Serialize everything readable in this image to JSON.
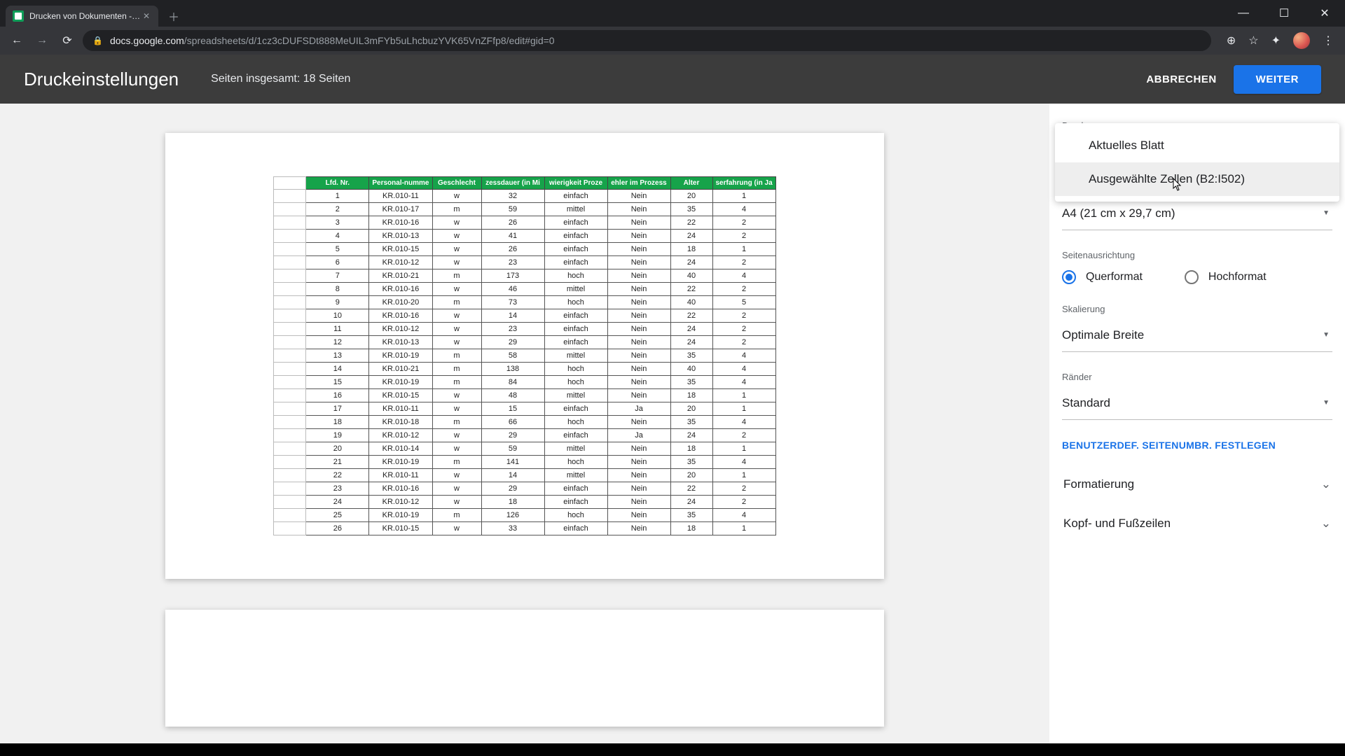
{
  "browser": {
    "tab_title": "Drucken von Dokumenten - Goo",
    "url_host": "docs.google.com",
    "url_path": "/spreadsheets/d/1cz3cDUFSDt888MeUIL3mFYb5uLhcbuzYVK65VnZFfp8/edit#gid=0"
  },
  "header": {
    "title": "Druckeinstellungen",
    "summary": "Seiten insgesamt: 18 Seiten",
    "cancel": "ABBRECHEN",
    "next": "WEITER"
  },
  "sidebar": {
    "print_label": "Drucken",
    "print_option1": "Aktuelles Blatt",
    "print_option2": "Ausgewählte Zellen (B2:I502)",
    "paper_size": "A4 (21 cm x 29,7 cm)",
    "orientation_label": "Seitenausrichtung",
    "orientation_landscape": "Querformat",
    "orientation_portrait": "Hochformat",
    "scaling_label": "Skalierung",
    "scaling_value": "Optimale Breite",
    "margins_label": "Ränder",
    "margins_value": "Standard",
    "custom_breaks": "BENUTZERDEF. SEITENUMBR. FESTLEGEN",
    "formatting": "Formatierung",
    "headers_footers": "Kopf- und Fußzeilen"
  },
  "table": {
    "headers": [
      "Lfd. Nr.",
      "Personal-numme",
      "Geschlecht",
      "zessdauer (in Mi",
      "wierigkeit Proze",
      "ehler im Prozess",
      "Alter",
      "serfahrung (in Ja"
    ],
    "rows": [
      [
        "1",
        "KR.010-11",
        "w",
        "32",
        "einfach",
        "Nein",
        "20",
        "1"
      ],
      [
        "2",
        "KR.010-17",
        "m",
        "59",
        "mittel",
        "Nein",
        "35",
        "4"
      ],
      [
        "3",
        "KR.010-16",
        "w",
        "26",
        "einfach",
        "Nein",
        "22",
        "2"
      ],
      [
        "4",
        "KR.010-13",
        "w",
        "41",
        "einfach",
        "Nein",
        "24",
        "2"
      ],
      [
        "5",
        "KR.010-15",
        "w",
        "26",
        "einfach",
        "Nein",
        "18",
        "1"
      ],
      [
        "6",
        "KR.010-12",
        "w",
        "23",
        "einfach",
        "Nein",
        "24",
        "2"
      ],
      [
        "7",
        "KR.010-21",
        "m",
        "173",
        "hoch",
        "Nein",
        "40",
        "4"
      ],
      [
        "8",
        "KR.010-16",
        "w",
        "46",
        "mittel",
        "Nein",
        "22",
        "2"
      ],
      [
        "9",
        "KR.010-20",
        "m",
        "73",
        "hoch",
        "Nein",
        "40",
        "5"
      ],
      [
        "10",
        "KR.010-16",
        "w",
        "14",
        "einfach",
        "Nein",
        "22",
        "2"
      ],
      [
        "11",
        "KR.010-12",
        "w",
        "23",
        "einfach",
        "Nein",
        "24",
        "2"
      ],
      [
        "12",
        "KR.010-13",
        "w",
        "29",
        "einfach",
        "Nein",
        "24",
        "2"
      ],
      [
        "13",
        "KR.010-19",
        "m",
        "58",
        "mittel",
        "Nein",
        "35",
        "4"
      ],
      [
        "14",
        "KR.010-21",
        "m",
        "138",
        "hoch",
        "Nein",
        "40",
        "4"
      ],
      [
        "15",
        "KR.010-19",
        "m",
        "84",
        "hoch",
        "Nein",
        "35",
        "4"
      ],
      [
        "16",
        "KR.010-15",
        "w",
        "48",
        "mittel",
        "Nein",
        "18",
        "1"
      ],
      [
        "17",
        "KR.010-11",
        "w",
        "15",
        "einfach",
        "Ja",
        "20",
        "1"
      ],
      [
        "18",
        "KR.010-18",
        "m",
        "66",
        "hoch",
        "Nein",
        "35",
        "4"
      ],
      [
        "19",
        "KR.010-12",
        "w",
        "29",
        "einfach",
        "Ja",
        "24",
        "2"
      ],
      [
        "20",
        "KR.010-14",
        "w",
        "59",
        "mittel",
        "Nein",
        "18",
        "1"
      ],
      [
        "21",
        "KR.010-19",
        "m",
        "141",
        "hoch",
        "Nein",
        "35",
        "4"
      ],
      [
        "22",
        "KR.010-11",
        "w",
        "14",
        "mittel",
        "Nein",
        "20",
        "1"
      ],
      [
        "23",
        "KR.010-16",
        "w",
        "29",
        "einfach",
        "Nein",
        "22",
        "2"
      ],
      [
        "24",
        "KR.010-12",
        "w",
        "18",
        "einfach",
        "Nein",
        "24",
        "2"
      ],
      [
        "25",
        "KR.010-19",
        "m",
        "126",
        "hoch",
        "Nein",
        "35",
        "4"
      ],
      [
        "26",
        "KR.010-15",
        "w",
        "33",
        "einfach",
        "Nein",
        "18",
        "1"
      ]
    ]
  }
}
